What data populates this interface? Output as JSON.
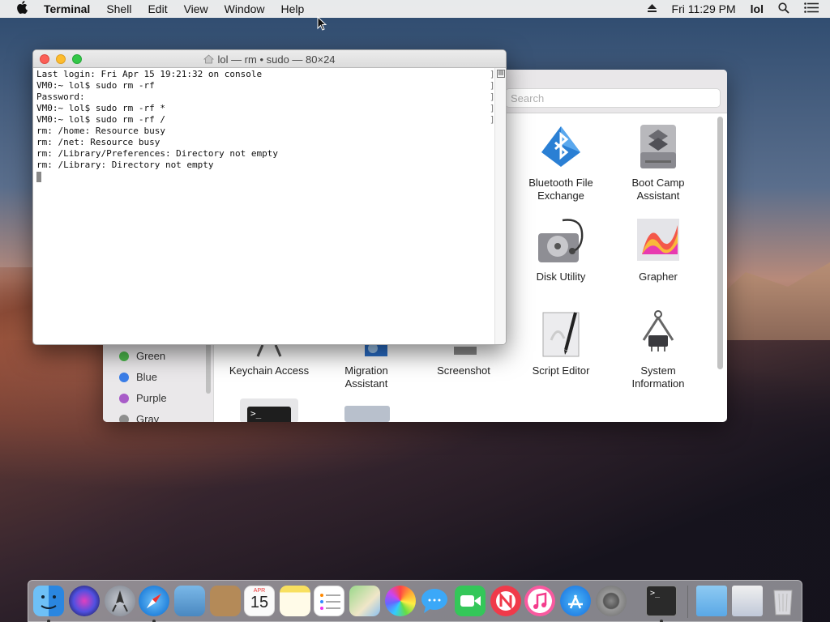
{
  "menubar": {
    "app_name": "Terminal",
    "items": [
      "Shell",
      "Edit",
      "View",
      "Window",
      "Help"
    ],
    "clock": "Fri 11:29 PM",
    "user": "lol"
  },
  "app_window": {
    "search_placeholder": "Search",
    "tags": [
      {
        "label": "Green",
        "color": "#4cb84c"
      },
      {
        "label": "Blue",
        "color": "#3b7ee8"
      },
      {
        "label": "Purple",
        "color": "#a85cc8"
      },
      {
        "label": "Gray",
        "color": "#8e8e8e"
      }
    ],
    "apps": {
      "bluetooth": "Bluetooth File\nExchange",
      "bootcamp": "Boot Camp\nAssistant",
      "disk": "Disk Utility",
      "grapher": "Grapher",
      "keychain": "Keychain Access",
      "migration": "Migration\nAssistant",
      "screenshot": "Screenshot",
      "script": "Script Editor",
      "sysinfo": "System\nInformation"
    }
  },
  "terminal": {
    "title": "lol — rm • sudo — 80×24",
    "lines": [
      "Last login: Fri Apr 15 19:21:32 on console",
      "VM0:~ lol$ sudo rm -rf",
      "Password:",
      "VM0:~ lol$ sudo rm -rf *",
      "VM0:~ lol$ sudo rm -rf /",
      "rm: /home: Resource busy",
      "rm: /net: Resource busy",
      "rm: /Library/Preferences: Directory not empty",
      "rm: /Library: Directory not empty"
    ]
  },
  "dock": {
    "calendar_month": "APR",
    "calendar_day": "15"
  },
  "colors": {
    "close": "#fc5f57",
    "minimize": "#fdbc2e",
    "zoom": "#33c748"
  }
}
